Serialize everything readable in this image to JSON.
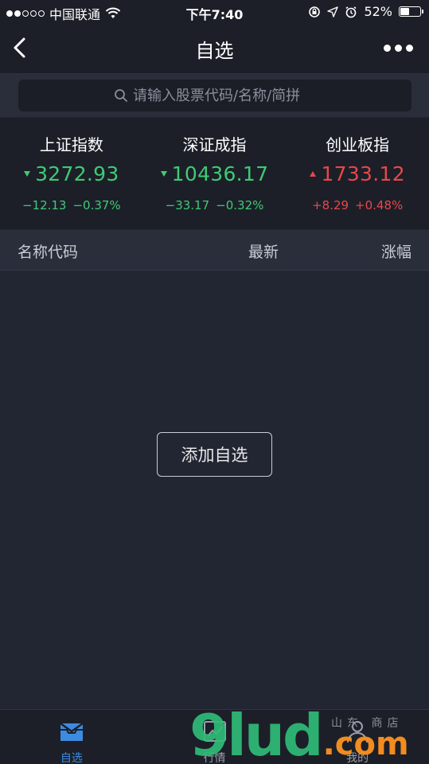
{
  "status_bar": {
    "carrier": "中国联通",
    "time": "下午7:40",
    "battery": "52%",
    "battery_level": 0.52,
    "signal_bars_filled": 2,
    "signal_bars_total": 5
  },
  "nav": {
    "title": "自选"
  },
  "search": {
    "placeholder": "请输入股票代码/名称/简拼"
  },
  "indices": [
    {
      "name": "上证指数",
      "value": "3272.93",
      "change": "−12.13",
      "change_pct": "−0.37%",
      "direction": "down",
      "color": "#3ecb74"
    },
    {
      "name": "深证成指",
      "value": "10436.17",
      "change": "−33.17",
      "change_pct": "−0.32%",
      "direction": "down",
      "color": "#3ecb74"
    },
    {
      "name": "创业板指",
      "value": "1733.12",
      "change": "+8.29",
      "change_pct": "+0.48%",
      "direction": "up",
      "color": "#e8474b"
    }
  ],
  "list_header": {
    "name_col": "名称代码",
    "latest_col": "最新",
    "change_col": "涨幅"
  },
  "content": {
    "add_button": "添加自选"
  },
  "tabs": [
    {
      "label": "自选",
      "icon": "watchlist-icon",
      "active": true
    },
    {
      "label": "行情",
      "icon": "chart-icon",
      "active": false
    },
    {
      "label": "我的",
      "icon": "user-icon",
      "active": false
    }
  ],
  "colors": {
    "active_tab": "#3d8be0",
    "inactive_tab": "#9aa0ad",
    "rise": "#e8474b",
    "fall": "#3ecb74"
  },
  "watermark": {
    "main": "9lud",
    "suffix": ".com",
    "sub": "山东 商店"
  }
}
